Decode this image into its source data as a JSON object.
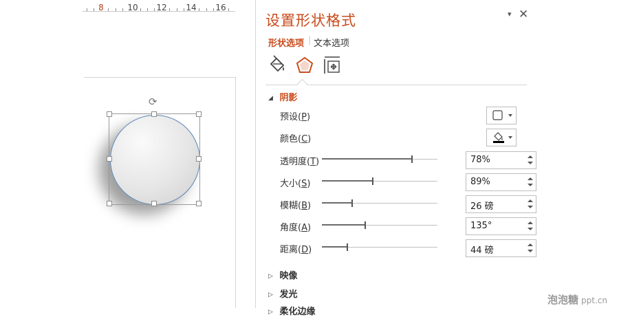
{
  "ruler": {
    "marks": [
      "8",
      "10",
      "12",
      "14",
      "16"
    ]
  },
  "pane": {
    "title": "设置形状格式",
    "dropdown_glyph": "▾",
    "close_glyph": "✕",
    "tabs": [
      {
        "label": "形状选项",
        "active": true
      },
      {
        "label": "文本选项",
        "active": false
      }
    ],
    "icons": [
      "fill-line-icon",
      "effects-pentagon-icon",
      "size-properties-icon"
    ]
  },
  "shadow": {
    "header": "阴影",
    "preset": {
      "label": "预设",
      "key": "P"
    },
    "color": {
      "label": "颜色",
      "key": "C"
    },
    "rows": [
      {
        "label": "透明度",
        "key": "T",
        "value": "78%",
        "level": 0.78
      },
      {
        "label": "大小",
        "key": "S",
        "value": "89%",
        "level": 0.44
      },
      {
        "label": "模糊",
        "key": "B",
        "value": "26 磅",
        "level": 0.26
      },
      {
        "label": "角度",
        "key": "A",
        "value": "135°",
        "level": 0.375
      },
      {
        "label": "距离",
        "key": "D",
        "value": "44 磅",
        "level": 0.22
      }
    ]
  },
  "sections": [
    {
      "label": "映像"
    },
    {
      "label": "发光"
    },
    {
      "label": "柔化边缘"
    }
  ],
  "colors": {
    "accent": "#c94b1c",
    "shape_outline": "#5a83b5"
  },
  "watermark": {
    "brand": "泡泡糖",
    "domain": "ppt.cn"
  }
}
